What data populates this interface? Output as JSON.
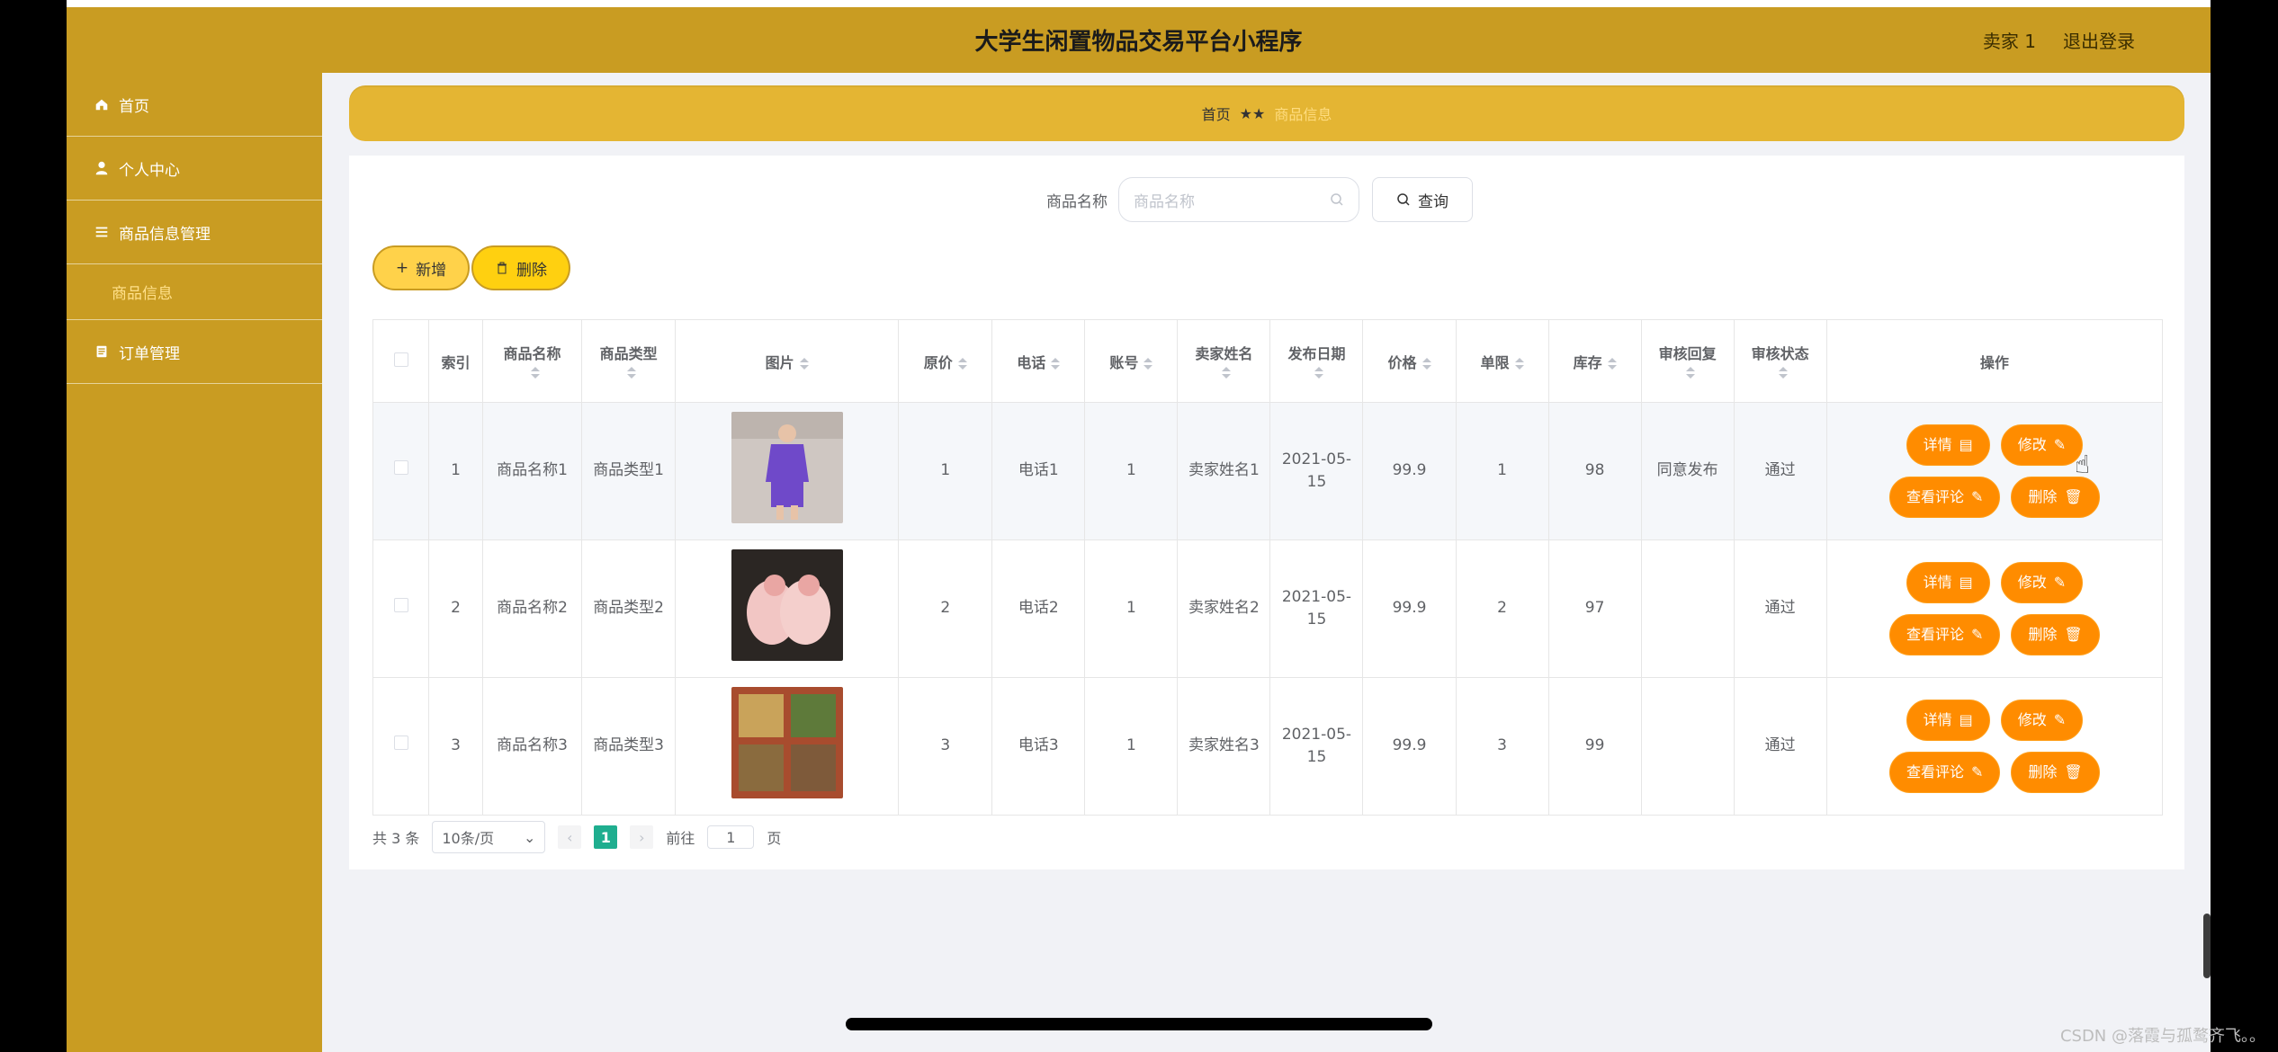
{
  "app_title": "大学生闲置物品交易平台小程序",
  "user": {
    "name": "卖家 1",
    "logout": "退出登录"
  },
  "sidebar": {
    "items": [
      {
        "label": "首页",
        "icon": "home-icon"
      },
      {
        "label": "个人中心",
        "icon": "user-icon"
      },
      {
        "label": "商品信息管理",
        "icon": "list-icon"
      },
      {
        "label": "商品信息",
        "icon": ""
      },
      {
        "label": "订单管理",
        "icon": "order-icon"
      }
    ]
  },
  "breadcrumb": {
    "home": "首页",
    "separator": "★★",
    "current": "商品信息"
  },
  "search": {
    "label": "商品名称",
    "placeholder": "商品名称",
    "button": "查询"
  },
  "toolbar": {
    "add": "新增",
    "delete": "删除"
  },
  "table": {
    "headers": [
      "索引",
      "商品名称",
      "商品类型",
      "图片",
      "原价",
      "电话",
      "账号",
      "卖家姓名",
      "发布日期",
      "价格",
      "单限",
      "库存",
      "审核回复",
      "审核状态",
      "操作"
    ],
    "rows": [
      {
        "index": "1",
        "name": "商品名称1",
        "type": "商品类型1",
        "image": "purple-outfit",
        "orig": "1",
        "phone": "电话1",
        "account": "1",
        "seller": "卖家姓名1",
        "date": "2021-05-15",
        "price": "99.9",
        "limit": "1",
        "stock": "98",
        "reply": "同意发布",
        "status": "通过"
      },
      {
        "index": "2",
        "name": "商品名称2",
        "type": "商品类型2",
        "image": "pink-shoes",
        "orig": "2",
        "phone": "电话2",
        "account": "1",
        "seller": "卖家姓名2",
        "date": "2021-05-15",
        "price": "99.9",
        "limit": "2",
        "stock": "97",
        "reply": "",
        "status": "通过"
      },
      {
        "index": "3",
        "name": "商品名称3",
        "type": "商品类型3",
        "image": "food-tray",
        "orig": "3",
        "phone": "电话3",
        "account": "1",
        "seller": "卖家姓名3",
        "date": "2021-05-15",
        "price": "99.9",
        "limit": "3",
        "stock": "99",
        "reply": "",
        "status": "通过"
      }
    ],
    "op_labels": {
      "detail": "详情",
      "edit": "修改",
      "comments": "查看评论",
      "delete": "删除"
    }
  },
  "pager": {
    "total": "共 3 条",
    "page_size": "10条/页",
    "current": "1",
    "goto_prefix": "前往",
    "goto_value": "1",
    "goto_suffix": "页"
  },
  "watermark": "CSDN @落霞与孤鹜齐飞。。",
  "colors": {
    "gold": "#C99C22",
    "orange": "#FF8C00",
    "teal": "#1FAE8F"
  }
}
